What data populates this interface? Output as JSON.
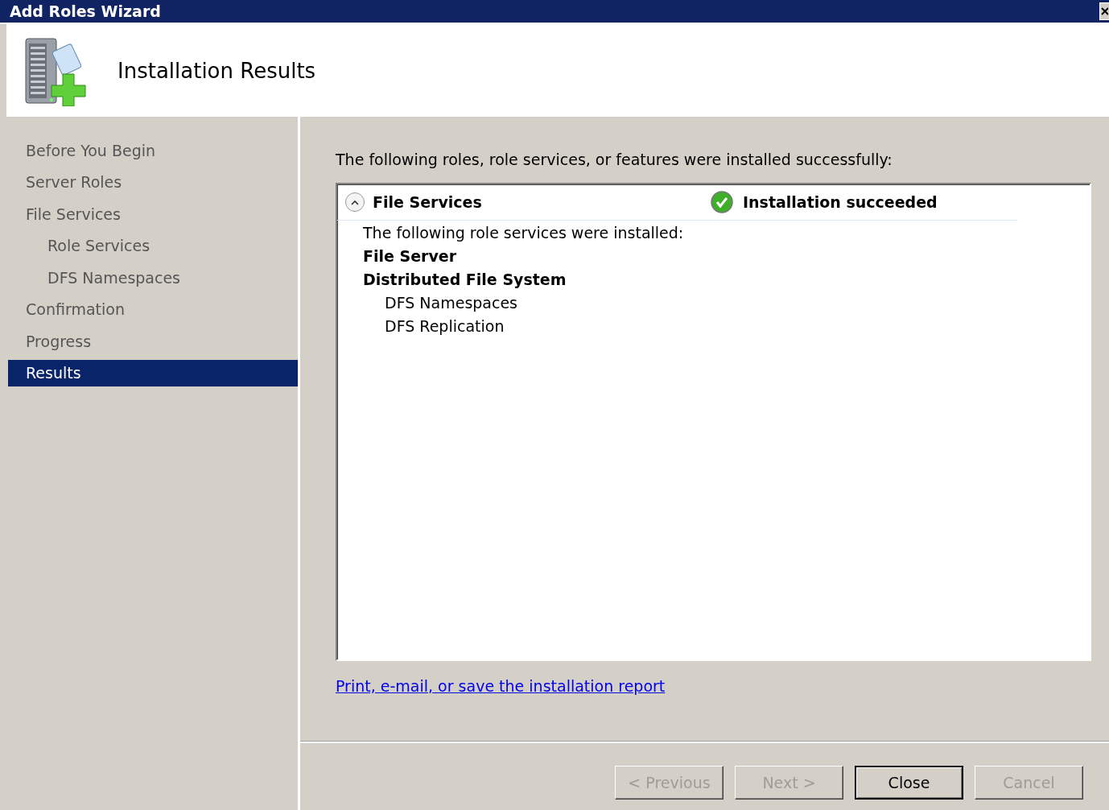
{
  "window": {
    "title": "Add Roles Wizard"
  },
  "header": {
    "title": "Installation Results"
  },
  "sidebar": {
    "items": [
      {
        "label": "Before You Begin",
        "selected": false
      },
      {
        "label": "Server Roles",
        "selected": false
      },
      {
        "label": "File Services",
        "selected": false,
        "children": [
          {
            "label": "Role Services",
            "selected": false
          },
          {
            "label": "DFS Namespaces",
            "selected": false
          }
        ]
      },
      {
        "label": "Confirmation",
        "selected": false
      },
      {
        "label": "Progress",
        "selected": false
      },
      {
        "label": "Results",
        "selected": true
      }
    ]
  },
  "intro": "The following roles, role services, or features were installed successfully:",
  "results": [
    {
      "name": "File Services",
      "expanded": true,
      "status": "Installation succeeded",
      "description": "The following role services were installed:",
      "services": [
        {
          "label": "File Server"
        },
        {
          "label": "Distributed File System",
          "children": [
            {
              "label": "DFS Namespaces"
            },
            {
              "label": "DFS Replication"
            }
          ]
        }
      ]
    }
  ],
  "report_link": "Print, e-mail, or save the installation report",
  "buttons": [
    {
      "label": "< Previous",
      "disabled": true,
      "default": false
    },
    {
      "label": "Next >",
      "disabled": true,
      "default": false
    },
    {
      "label": "Close",
      "disabled": false,
      "default": true
    },
    {
      "label": "Cancel",
      "disabled": true,
      "default": false
    }
  ]
}
